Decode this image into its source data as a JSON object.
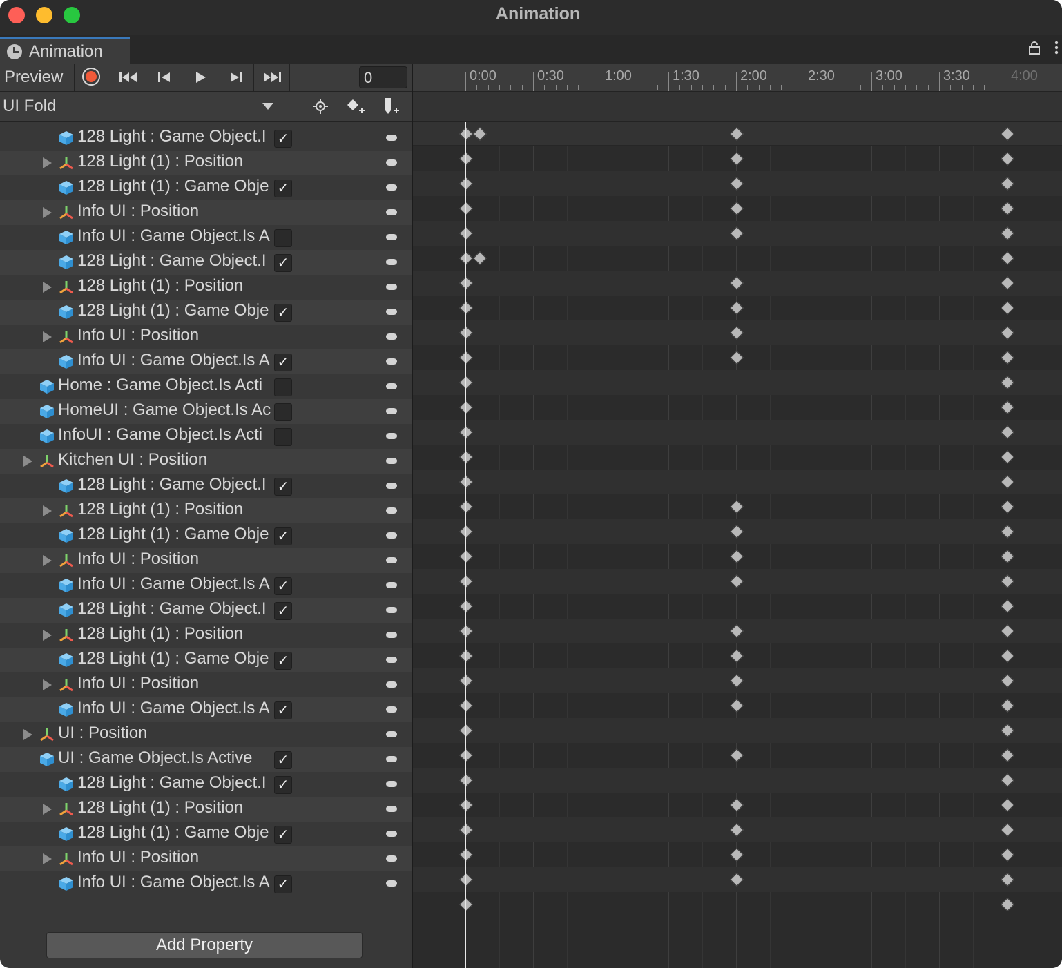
{
  "window": {
    "title": "Animation"
  },
  "tab": {
    "label": "Animation",
    "icon": "clock-icon"
  },
  "controls": {
    "preview_label": "Preview",
    "frame_value": "0",
    "record_color": "#f05a3a",
    "buttons": [
      "record-icon",
      "first-key-icon",
      "prev-key-icon",
      "play-icon",
      "next-key-icon",
      "last-key-icon"
    ]
  },
  "clip": {
    "name": "UI Fold",
    "tools": [
      "filter-target-icon",
      "add-keyframe-icon",
      "add-event-icon"
    ]
  },
  "timeline": {
    "ticks": [
      "0:00",
      "0:30",
      "1:00",
      "1:30",
      "2:00",
      "2:30",
      "3:00",
      "3:30",
      "4:00"
    ],
    "summary_keys": [
      0,
      0.1,
      2.0,
      4.0
    ]
  },
  "properties": [
    {
      "label": "128 Light : Game Object.I",
      "type": "active",
      "indent": 2,
      "checkbox": "checked",
      "keys": [
        0,
        2,
        4
      ]
    },
    {
      "label": "128 Light (1) : Position",
      "type": "position",
      "indent": 2,
      "keys": [
        0,
        2,
        4
      ]
    },
    {
      "label": "128 Light (1) : Game Obje",
      "type": "active",
      "indent": 2,
      "checkbox": "checked",
      "keys": [
        0,
        2,
        4
      ]
    },
    {
      "label": "Info UI : Position",
      "type": "position",
      "indent": 2,
      "keys": [
        0,
        2,
        4
      ]
    },
    {
      "label": "Info UI : Game Object.Is A",
      "type": "active",
      "indent": 2,
      "checkbox": "unchecked",
      "keys": [
        0,
        0.1,
        4
      ]
    },
    {
      "label": "128 Light : Game Object.I",
      "type": "active",
      "indent": 2,
      "checkbox": "checked",
      "keys": [
        0,
        2,
        4
      ]
    },
    {
      "label": "128 Light (1) : Position",
      "type": "position",
      "indent": 2,
      "keys": [
        0,
        2,
        4
      ]
    },
    {
      "label": "128 Light (1) : Game Obje",
      "type": "active",
      "indent": 2,
      "checkbox": "checked",
      "keys": [
        0,
        2,
        4
      ]
    },
    {
      "label": "Info UI : Position",
      "type": "position",
      "indent": 2,
      "keys": [
        0,
        2,
        4
      ]
    },
    {
      "label": "Info UI : Game Object.Is A",
      "type": "active",
      "indent": 2,
      "checkbox": "checked",
      "keys": [
        0,
        4
      ]
    },
    {
      "label": "Home : Game Object.Is Acti",
      "type": "active",
      "indent": 1,
      "checkbox": "unchecked",
      "keys": [
        0,
        4
      ]
    },
    {
      "label": "HomeUI : Game Object.Is Ac",
      "type": "active",
      "indent": 1,
      "checkbox": "unchecked",
      "keys": [
        0,
        4
      ]
    },
    {
      "label": "InfoUI : Game Object.Is Acti",
      "type": "active",
      "indent": 1,
      "checkbox": "unchecked",
      "keys": [
        0,
        4
      ]
    },
    {
      "label": "Kitchen UI : Position",
      "type": "position",
      "indent": 1,
      "keys": [
        0,
        4
      ]
    },
    {
      "label": "128 Light : Game Object.I",
      "type": "active",
      "indent": 2,
      "checkbox": "checked",
      "keys": [
        0,
        2,
        4
      ]
    },
    {
      "label": "128 Light (1) : Position",
      "type": "position",
      "indent": 2,
      "keys": [
        0,
        2,
        4
      ]
    },
    {
      "label": "128 Light (1) : Game Obje",
      "type": "active",
      "indent": 2,
      "checkbox": "checked",
      "keys": [
        0,
        2,
        4
      ]
    },
    {
      "label": "Info UI : Position",
      "type": "position",
      "indent": 2,
      "keys": [
        0,
        2,
        4
      ]
    },
    {
      "label": "Info UI : Game Object.Is A",
      "type": "active",
      "indent": 2,
      "checkbox": "checked",
      "keys": [
        0,
        4
      ]
    },
    {
      "label": "128 Light : Game Object.I",
      "type": "active",
      "indent": 2,
      "checkbox": "checked",
      "keys": [
        0,
        2,
        4
      ]
    },
    {
      "label": "128 Light (1) : Position",
      "type": "position",
      "indent": 2,
      "keys": [
        0,
        2,
        4
      ]
    },
    {
      "label": "128 Light (1) : Game Obje",
      "type": "active",
      "indent": 2,
      "checkbox": "checked",
      "keys": [
        0,
        2,
        4
      ]
    },
    {
      "label": "Info UI : Position",
      "type": "position",
      "indent": 2,
      "keys": [
        0,
        2,
        4
      ]
    },
    {
      "label": "Info UI : Game Object.Is A",
      "type": "active",
      "indent": 2,
      "checkbox": "checked",
      "keys": [
        0,
        4
      ]
    },
    {
      "label": "UI : Position",
      "type": "position",
      "indent": 1,
      "keys": [
        0,
        2,
        4
      ]
    },
    {
      "label": "UI : Game Object.Is Active",
      "type": "active",
      "indent": 1,
      "checkbox": "checked",
      "keys": [
        0,
        4
      ]
    },
    {
      "label": "128 Light : Game Object.I",
      "type": "active",
      "indent": 2,
      "checkbox": "checked",
      "keys": [
        0,
        2,
        4
      ]
    },
    {
      "label": "128 Light (1) : Position",
      "type": "position",
      "indent": 2,
      "keys": [
        0,
        2,
        4
      ]
    },
    {
      "label": "128 Light (1) : Game Obje",
      "type": "active",
      "indent": 2,
      "checkbox": "checked",
      "keys": [
        0,
        2,
        4
      ]
    },
    {
      "label": "Info UI : Position",
      "type": "position",
      "indent": 2,
      "keys": [
        0,
        2,
        4
      ]
    },
    {
      "label": "Info UI : Game Object.Is A",
      "type": "active",
      "indent": 2,
      "checkbox": "checked",
      "keys": [
        0,
        4
      ]
    }
  ],
  "add_property_label": "Add Property",
  "colors": {
    "accent": "#3a79bb",
    "cube": "#5ab4ee",
    "keyframe": "#b8b8b8"
  }
}
